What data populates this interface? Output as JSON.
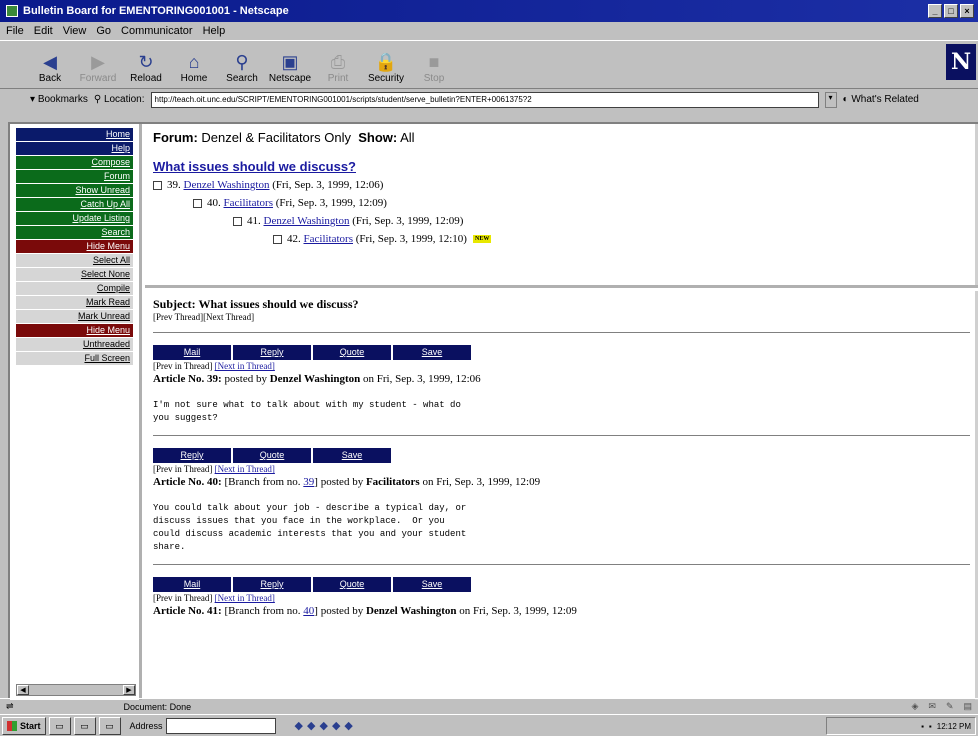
{
  "window": {
    "title": "Bulletin Board for EMENTORING001001 - Netscape"
  },
  "menu": [
    "File",
    "Edit",
    "View",
    "Go",
    "Communicator",
    "Help"
  ],
  "toolbar": [
    {
      "label": "Back",
      "icon": "back-arrow-icon",
      "glyph": "◀",
      "enabled": true
    },
    {
      "label": "Forward",
      "icon": "forward-arrow-icon",
      "glyph": "▶",
      "enabled": false
    },
    {
      "label": "Reload",
      "icon": "reload-icon",
      "glyph": "↻",
      "enabled": true
    },
    {
      "label": "Home",
      "icon": "home-icon",
      "glyph": "⌂",
      "enabled": true
    },
    {
      "label": "Search",
      "icon": "search-icon",
      "glyph": "⚲",
      "enabled": true
    },
    {
      "label": "Netscape",
      "icon": "netscape-icon",
      "glyph": "▣",
      "enabled": true
    },
    {
      "label": "Print",
      "icon": "print-icon",
      "glyph": "⎙",
      "enabled": false
    },
    {
      "label": "Security",
      "icon": "lock-icon",
      "glyph": "🔒",
      "enabled": true
    },
    {
      "label": "Stop",
      "icon": "stop-icon",
      "glyph": "■",
      "enabled": false
    }
  ],
  "location": {
    "bookmarks_label": "Bookmarks",
    "location_label": "Location:",
    "url": "http://teach.oit.unc.edu/SCRIPT/EMENTORING001001/scripts/student/serve_bulletin?ENTER+0061375?2",
    "whats_related": "What's Related"
  },
  "nav": [
    {
      "label": "Home",
      "style": "blue"
    },
    {
      "label": "Help",
      "style": "blue"
    },
    {
      "label": "Compose",
      "style": "green"
    },
    {
      "label": "Forum",
      "style": "green"
    },
    {
      "label": "Show Unread",
      "style": "green"
    },
    {
      "label": "Catch Up All",
      "style": "green"
    },
    {
      "label": "Update Listing",
      "style": "green"
    },
    {
      "label": "Search",
      "style": "green"
    },
    {
      "label": "Hide Menu",
      "style": "maroon"
    },
    {
      "label": "Select All",
      "style": "gray"
    },
    {
      "label": "Select None",
      "style": "gray"
    },
    {
      "label": "Compile",
      "style": "gray"
    },
    {
      "label": "Mark Read",
      "style": "gray"
    },
    {
      "label": "Mark Unread",
      "style": "gray"
    },
    {
      "label": "Hide Menu",
      "style": "maroon"
    },
    {
      "label": "Unthreaded",
      "style": "gray"
    },
    {
      "label": "Full Screen",
      "style": "gray"
    }
  ],
  "forum": {
    "forum_label": "Forum:",
    "forum_name": "Denzel & Facilitators Only",
    "show_label": "Show:",
    "show_value": "All",
    "thread_title": "What issues should we discuss?",
    "tree": [
      {
        "num": "39.",
        "author": "Denzel Washington",
        "date": "(Fri, Sep. 3, 1999, 12:06)",
        "indent": 0,
        "new": false
      },
      {
        "num": "40.",
        "author": "Facilitators",
        "date": "(Fri, Sep. 3, 1999, 12:09)",
        "indent": 1,
        "new": false
      },
      {
        "num": "41.",
        "author": "Denzel Washington",
        "date": "(Fri, Sep. 3, 1999, 12:09)",
        "indent": 2,
        "new": false
      },
      {
        "num": "42.",
        "author": "Facilitators",
        "date": "(Fri, Sep. 3, 1999, 12:10)",
        "indent": 3,
        "new": true,
        "badge": "NEW"
      }
    ]
  },
  "message": {
    "subject_label": "Subject:",
    "subject": "What issues should we discuss?",
    "prev_thread": "[Prev Thread]",
    "next_thread": "[Next Thread]",
    "articles": [
      {
        "buttons": [
          "Mail",
          "Reply",
          "Quote",
          "Save"
        ],
        "prev_in_thread": "[Prev in Thread]",
        "next_in_thread": "[Next in Thread]",
        "label": "Article No. 39:",
        "branch_prefix": "",
        "branch_no": "",
        "branch_suffix": "",
        "posted_by": "posted by",
        "author": "Denzel Washington",
        "on": "on Fri, Sep. 3, 1999, 12:06",
        "body": "I'm not sure what to talk about with my student - what do\nyou suggest?"
      },
      {
        "buttons": [
          "Reply",
          "Quote",
          "Save"
        ],
        "prev_in_thread": "[Prev in Thread]",
        "next_in_thread": "[Next in Thread]",
        "label": "Article No. 40:",
        "branch_prefix": "[Branch from no.",
        "branch_no": "39",
        "branch_suffix": "]",
        "posted_by": "posted by",
        "author": "Facilitators",
        "on": "on Fri, Sep. 3, 1999, 12:09",
        "body": "You could talk about your job - describe a typical day, or\ndiscuss issues that you face in the workplace.  Or you\ncould discuss academic interests that you and your student\nshare."
      },
      {
        "buttons": [
          "Mail",
          "Reply",
          "Quote",
          "Save"
        ],
        "prev_in_thread": "[Prev in Thread]",
        "next_in_thread": "[Next in Thread]",
        "label": "Article No. 41:",
        "branch_prefix": "[Branch from no.",
        "branch_no": "40",
        "branch_suffix": "]",
        "posted_by": "posted by",
        "author": "Denzel Washington",
        "on": "on Fri, Sep. 3, 1999, 12:09",
        "body": ""
      }
    ]
  },
  "status": {
    "text": "Document: Done"
  },
  "taskbar": {
    "start": "Start",
    "address_label": "Address",
    "clock": "12:12 PM"
  }
}
